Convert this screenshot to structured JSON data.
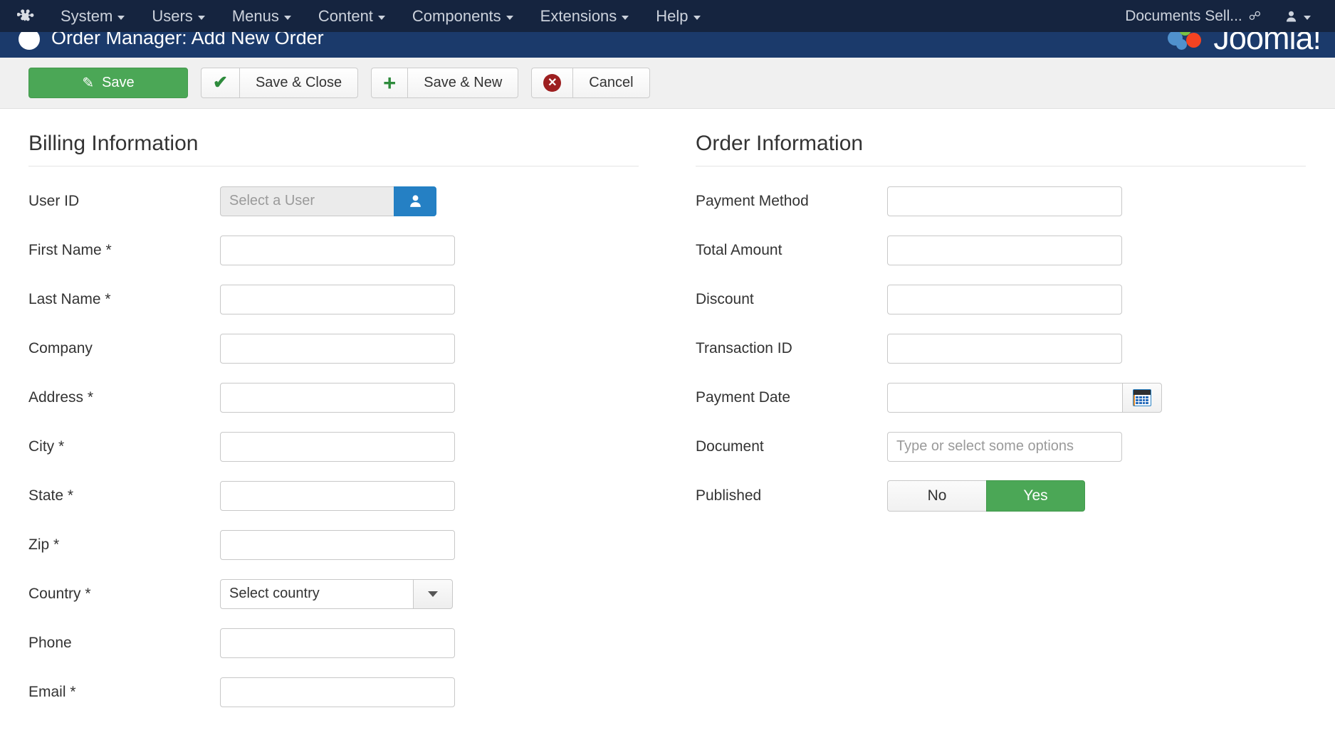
{
  "navbar": {
    "logo_icon": "joomla-logo-icon",
    "menus": [
      {
        "label": "System"
      },
      {
        "label": "Users"
      },
      {
        "label": "Menus"
      },
      {
        "label": "Content"
      },
      {
        "label": "Components"
      },
      {
        "label": "Extensions"
      },
      {
        "label": "Help"
      }
    ],
    "site_name": "Documents Sell...",
    "site_link_icon": "external-link-icon",
    "user_icon": "user-icon",
    "background_color": "#15243f"
  },
  "subhead": {
    "title": "Order Manager: Add New Order",
    "brand": "Joomla!",
    "background_color": "#1b3a6b"
  },
  "toolbar": {
    "save_label": "Save",
    "save_icon": "pencil-square-icon",
    "save_close_label": "Save & Close",
    "save_close_icon": "check-icon",
    "save_new_label": "Save & New",
    "save_new_icon": "plus-icon",
    "cancel_label": "Cancel",
    "cancel_icon": "cancel-circle-icon",
    "primary_color": "#4ba756"
  },
  "billing": {
    "section_title": "Billing Information",
    "fields": [
      {
        "label": "User ID",
        "type": "user-picker",
        "value": "",
        "placeholder": "Select a User",
        "button_icon": "user-icon"
      },
      {
        "label": "First Name *",
        "type": "text",
        "value": "",
        "placeholder": ""
      },
      {
        "label": "Last Name *",
        "type": "text",
        "value": "",
        "placeholder": ""
      },
      {
        "label": "Company",
        "type": "text",
        "value": "",
        "placeholder": ""
      },
      {
        "label": "Address *",
        "type": "text",
        "value": "",
        "placeholder": ""
      },
      {
        "label": "City *",
        "type": "text",
        "value": "",
        "placeholder": ""
      },
      {
        "label": "State *",
        "type": "text",
        "value": "",
        "placeholder": ""
      },
      {
        "label": "Zip *",
        "type": "text",
        "value": "",
        "placeholder": ""
      },
      {
        "label": "Country *",
        "type": "select",
        "value": "Select country",
        "placeholder": ""
      },
      {
        "label": "Phone",
        "type": "text",
        "value": "",
        "placeholder": ""
      },
      {
        "label": "Email *",
        "type": "text",
        "value": "",
        "placeholder": ""
      }
    ]
  },
  "order": {
    "section_title": "Order Information",
    "fields": [
      {
        "label": "Payment Method",
        "type": "text",
        "value": "",
        "placeholder": ""
      },
      {
        "label": "Total Amount",
        "type": "text",
        "value": "",
        "placeholder": ""
      },
      {
        "label": "Discount",
        "type": "text",
        "value": "",
        "placeholder": ""
      },
      {
        "label": "Transaction ID",
        "type": "text",
        "value": "",
        "placeholder": ""
      },
      {
        "label": "Payment Date",
        "type": "date",
        "value": "",
        "placeholder": "",
        "button_icon": "calendar-icon"
      },
      {
        "label": "Document",
        "type": "tags",
        "value": "",
        "placeholder": "Type or select some options"
      }
    ],
    "published": {
      "label": "Published",
      "option_no": "No",
      "option_yes": "Yes",
      "selected": "Yes",
      "selected_color": "#4ba756"
    }
  }
}
